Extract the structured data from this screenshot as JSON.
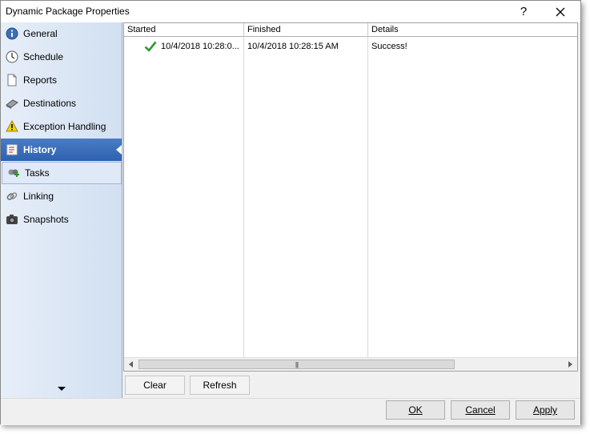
{
  "window": {
    "title": "Dynamic Package Properties",
    "help_label": "?",
    "close_label": "✕"
  },
  "sidebar": {
    "items": [
      {
        "label": "General",
        "icon": "info-icon"
      },
      {
        "label": "Schedule",
        "icon": "clock-icon"
      },
      {
        "label": "Reports",
        "icon": "document-icon"
      },
      {
        "label": "Destinations",
        "icon": "destinations-icon"
      },
      {
        "label": "Exception Handling",
        "icon": "warning-icon"
      },
      {
        "label": "History",
        "icon": "history-icon"
      },
      {
        "label": "Tasks",
        "icon": "tasks-icon"
      },
      {
        "label": "Linking",
        "icon": "link-icon"
      },
      {
        "label": "Snapshots",
        "icon": "camera-icon"
      }
    ],
    "active": "History"
  },
  "history_grid": {
    "columns": [
      "Started",
      "Finished",
      "Details"
    ],
    "rows": [
      {
        "status": "success",
        "started": "10/4/2018 10:28:0...",
        "finished": "10/4/2018 10:28:15 AM",
        "details": "Success!"
      }
    ],
    "scroll_grip": "|||"
  },
  "actions": {
    "clear_label": "Clear",
    "refresh_label": "Refresh"
  },
  "footer": {
    "ok_label": "OK",
    "cancel_label": "Cancel",
    "apply_label": "Apply"
  },
  "colors": {
    "active_item": "#2e62b0",
    "sidebar_bg": "#d2e0f2",
    "success_check": "#2e9a2e"
  }
}
